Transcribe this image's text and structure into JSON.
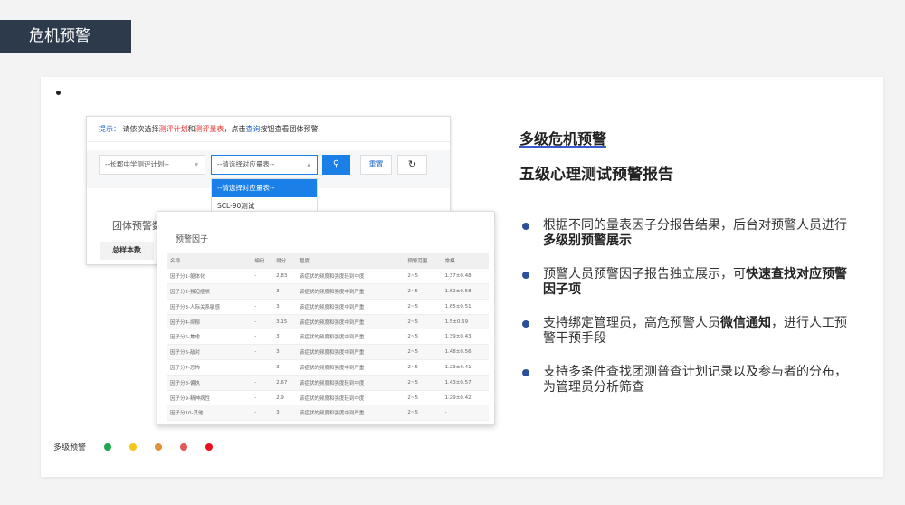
{
  "title": "危机预警",
  "screenshot": {
    "tip": {
      "label": "提示：",
      "t1": "请依次选择",
      "plan": "测评计划",
      "and": "和",
      "scale": "测评量表",
      "t2": "，点击",
      "query": "查询",
      "t3": "按钮查看团体预警"
    },
    "plan_select": "--长郡中学测评计划--",
    "scale_select": "--请选择对应量表--",
    "search_icon": "search-icon",
    "reset": "重置",
    "refresh_icon": "refresh-icon",
    "dropdown": [
      "--请选择对应量表--",
      "SCL-90测试"
    ],
    "group_title": "团体预警数",
    "total_samples": "总样本数",
    "factor_title": "预警因子",
    "columns": [
      "名称",
      "编码",
      "得分",
      "程度",
      "预警范围",
      "常模"
    ],
    "rows": [
      [
        "因子分1-躯体化",
        "-",
        "2.83",
        "该症状的频度和强度轻到中度",
        "2~5",
        "1.37±0.48"
      ],
      [
        "因子分2-强迫症状",
        "-",
        "3",
        "该症状的频度和强度中到严重",
        "2~5",
        "1.62±0.58"
      ],
      [
        "因子分3-人际关系敏感",
        "-",
        "3",
        "该症状的频度和强度中到严重",
        "2~5",
        "1.65±0.51"
      ],
      [
        "因子分4-抑郁",
        "-",
        "3.15",
        "该症状的频度和强度中到严重",
        "2~5",
        "1.5±0.59"
      ],
      [
        "因子分5-焦虑",
        "-",
        "3",
        "该症状的频度和强度中到严重",
        "2~5",
        "1.39±0.43"
      ],
      [
        "因子分6-敌对",
        "-",
        "3",
        "该症状的频度和强度中到严重",
        "2~5",
        "1.48±0.56"
      ],
      [
        "因子分7-恐怖",
        "-",
        "3",
        "该症状的频度和强度中到严重",
        "2~5",
        "1.23±0.41"
      ],
      [
        "因子分8-偏执",
        "-",
        "2.67",
        "该症状的频度和强度轻到中度",
        "2~5",
        "1.43±0.57"
      ],
      [
        "因子分9-精神病性",
        "-",
        "2.9",
        "该症状的频度和强度轻到中度",
        "2~5",
        "1.29±0.42"
      ],
      [
        "因子分10-其他",
        "-",
        "3",
        "该症状的频度和强度中到严重",
        "2~5",
        "-"
      ]
    ]
  },
  "right": {
    "heading": "多级危机预警",
    "subheading": "五级心理测试预警报告",
    "bullets": [
      {
        "pre": "根据不同的量表因子分报告结果，后台对预警人员进行",
        "bold": "多级别预警展示",
        "post": ""
      },
      {
        "pre": "预警人员预警因子报告独立展示，可",
        "bold": "快速查找对应预警因子项",
        "post": ""
      },
      {
        "pre": "支持绑定管理员，高危预警人员",
        "bold": "微信通知",
        "post": "，进行人工预警干预手段"
      },
      {
        "pre": "支持多条件查找团测普查计划记录以及参与者的分布，为管理员分析筛查",
        "bold": "",
        "post": ""
      }
    ]
  },
  "legend": {
    "label": "多级预警",
    "colors": [
      "#1aa84e",
      "#f5c518",
      "#e0923a",
      "#e05a5a",
      "#e8101a"
    ]
  }
}
